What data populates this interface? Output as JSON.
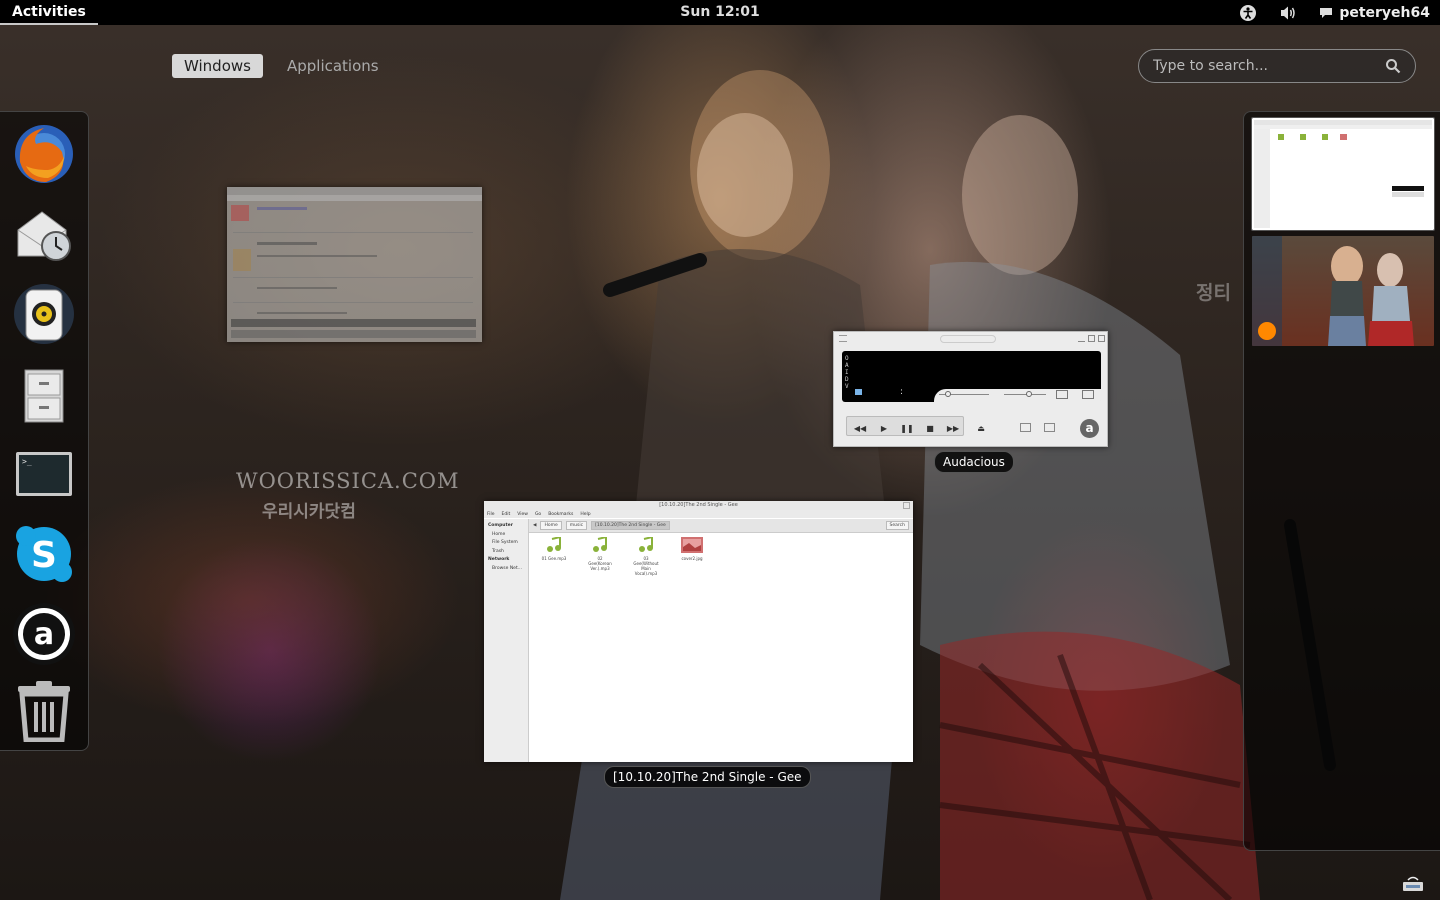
{
  "top_panel": {
    "activities": "Activities",
    "clock": "Sun 12:01",
    "user": "peteryeh64",
    "icons": [
      "accessibility-icon",
      "volume-icon",
      "chat-icon"
    ]
  },
  "overview": {
    "tabs": [
      {
        "label": "Windows",
        "active": true
      },
      {
        "label": "Applications",
        "active": false
      }
    ],
    "search_placeholder": "Type to search..."
  },
  "dash": {
    "items": [
      "firefox",
      "evolution",
      "rhythmbox",
      "file-cabinet",
      "terminal",
      "skype",
      "audacious",
      "trash"
    ]
  },
  "windows": {
    "audacious": {
      "label": "Audacious",
      "display_chars": "O A I D V",
      "colon": ":"
    },
    "nautilus": {
      "label": "[10.10.20]The 2nd Single - Gee",
      "title": "[10.10.20]The 2nd Single - Gee",
      "menu": [
        "File",
        "Edit",
        "View",
        "Go",
        "Bookmarks",
        "Help"
      ],
      "crumbs": [
        "Home",
        "music",
        "[10.10.20]The 2nd Single - Gee"
      ],
      "search_button": "Search",
      "sidebar": [
        "Computer",
        "Home",
        "File System",
        "Trash",
        "Network",
        "Browse Net..."
      ],
      "files": [
        {
          "name": "01 Gee.mp3",
          "kind": "audio"
        },
        {
          "name": "02 Gee(Korean Ver.).mp3",
          "kind": "audio"
        },
        {
          "name": "03 Gee(Without Main Vocal).mp3",
          "kind": "audio"
        },
        {
          "name": "cover2.jpg",
          "kind": "image"
        }
      ]
    }
  },
  "wallpaper": {
    "watermark": "WOORISSICA.COM",
    "watermark_sub": "우리시카닷컴",
    "side_text": "정티"
  },
  "colors": {
    "panel": "#000000",
    "tab_active_bg": "#d8d8d8",
    "dash_bg": "rgba(0,0,0,0.55)"
  }
}
